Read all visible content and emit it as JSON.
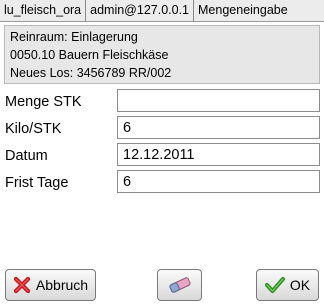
{
  "titlebar": {
    "app": "lu_fleisch_ora",
    "user": "admin@127.0.0.1",
    "screen": "Mengeneingabe"
  },
  "info": {
    "line1": "Reinraum: Einlagerung",
    "line2": "0050.10 Bauern Fleischkäse",
    "line3": "Neues Los: 3456789 RR/002"
  },
  "form": {
    "menge_label": "Menge STK",
    "menge_value": "",
    "kilo_label": "Kilo/STK",
    "kilo_value": "6",
    "datum_label": "Datum",
    "datum_value": "12.12.2011",
    "frist_label": "Frist Tage",
    "frist_value": "6"
  },
  "buttons": {
    "cancel_label": "Abbruch",
    "ok_label": "OK"
  },
  "icons": {
    "cancel": "red-x-icon",
    "eraser": "eraser-icon",
    "ok": "green-check-icon"
  }
}
